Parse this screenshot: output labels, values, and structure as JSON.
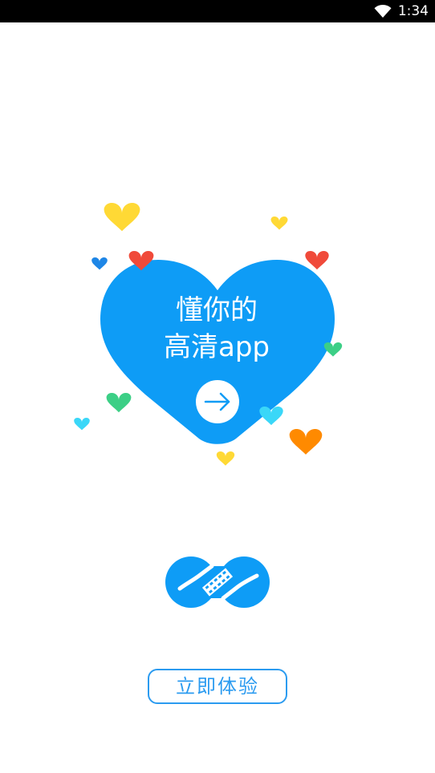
{
  "status_bar": {
    "time": "1:34",
    "wifi_icon": "wifi-icon"
  },
  "hero": {
    "line1": "懂你的",
    "line2": "高清app",
    "arrow_icon": "arrow-right-icon",
    "main_heart_color": "#0e9cf6",
    "confetti_colors": [
      "#ffd935",
      "#f04a3a",
      "#1e86e6",
      "#3ccf86",
      "#3ad7f8",
      "#ff8a00"
    ]
  },
  "logo": {
    "icon": "infinity-film-logo-icon",
    "color": "#0e9cf6"
  },
  "cta": {
    "label": "立即体验"
  }
}
